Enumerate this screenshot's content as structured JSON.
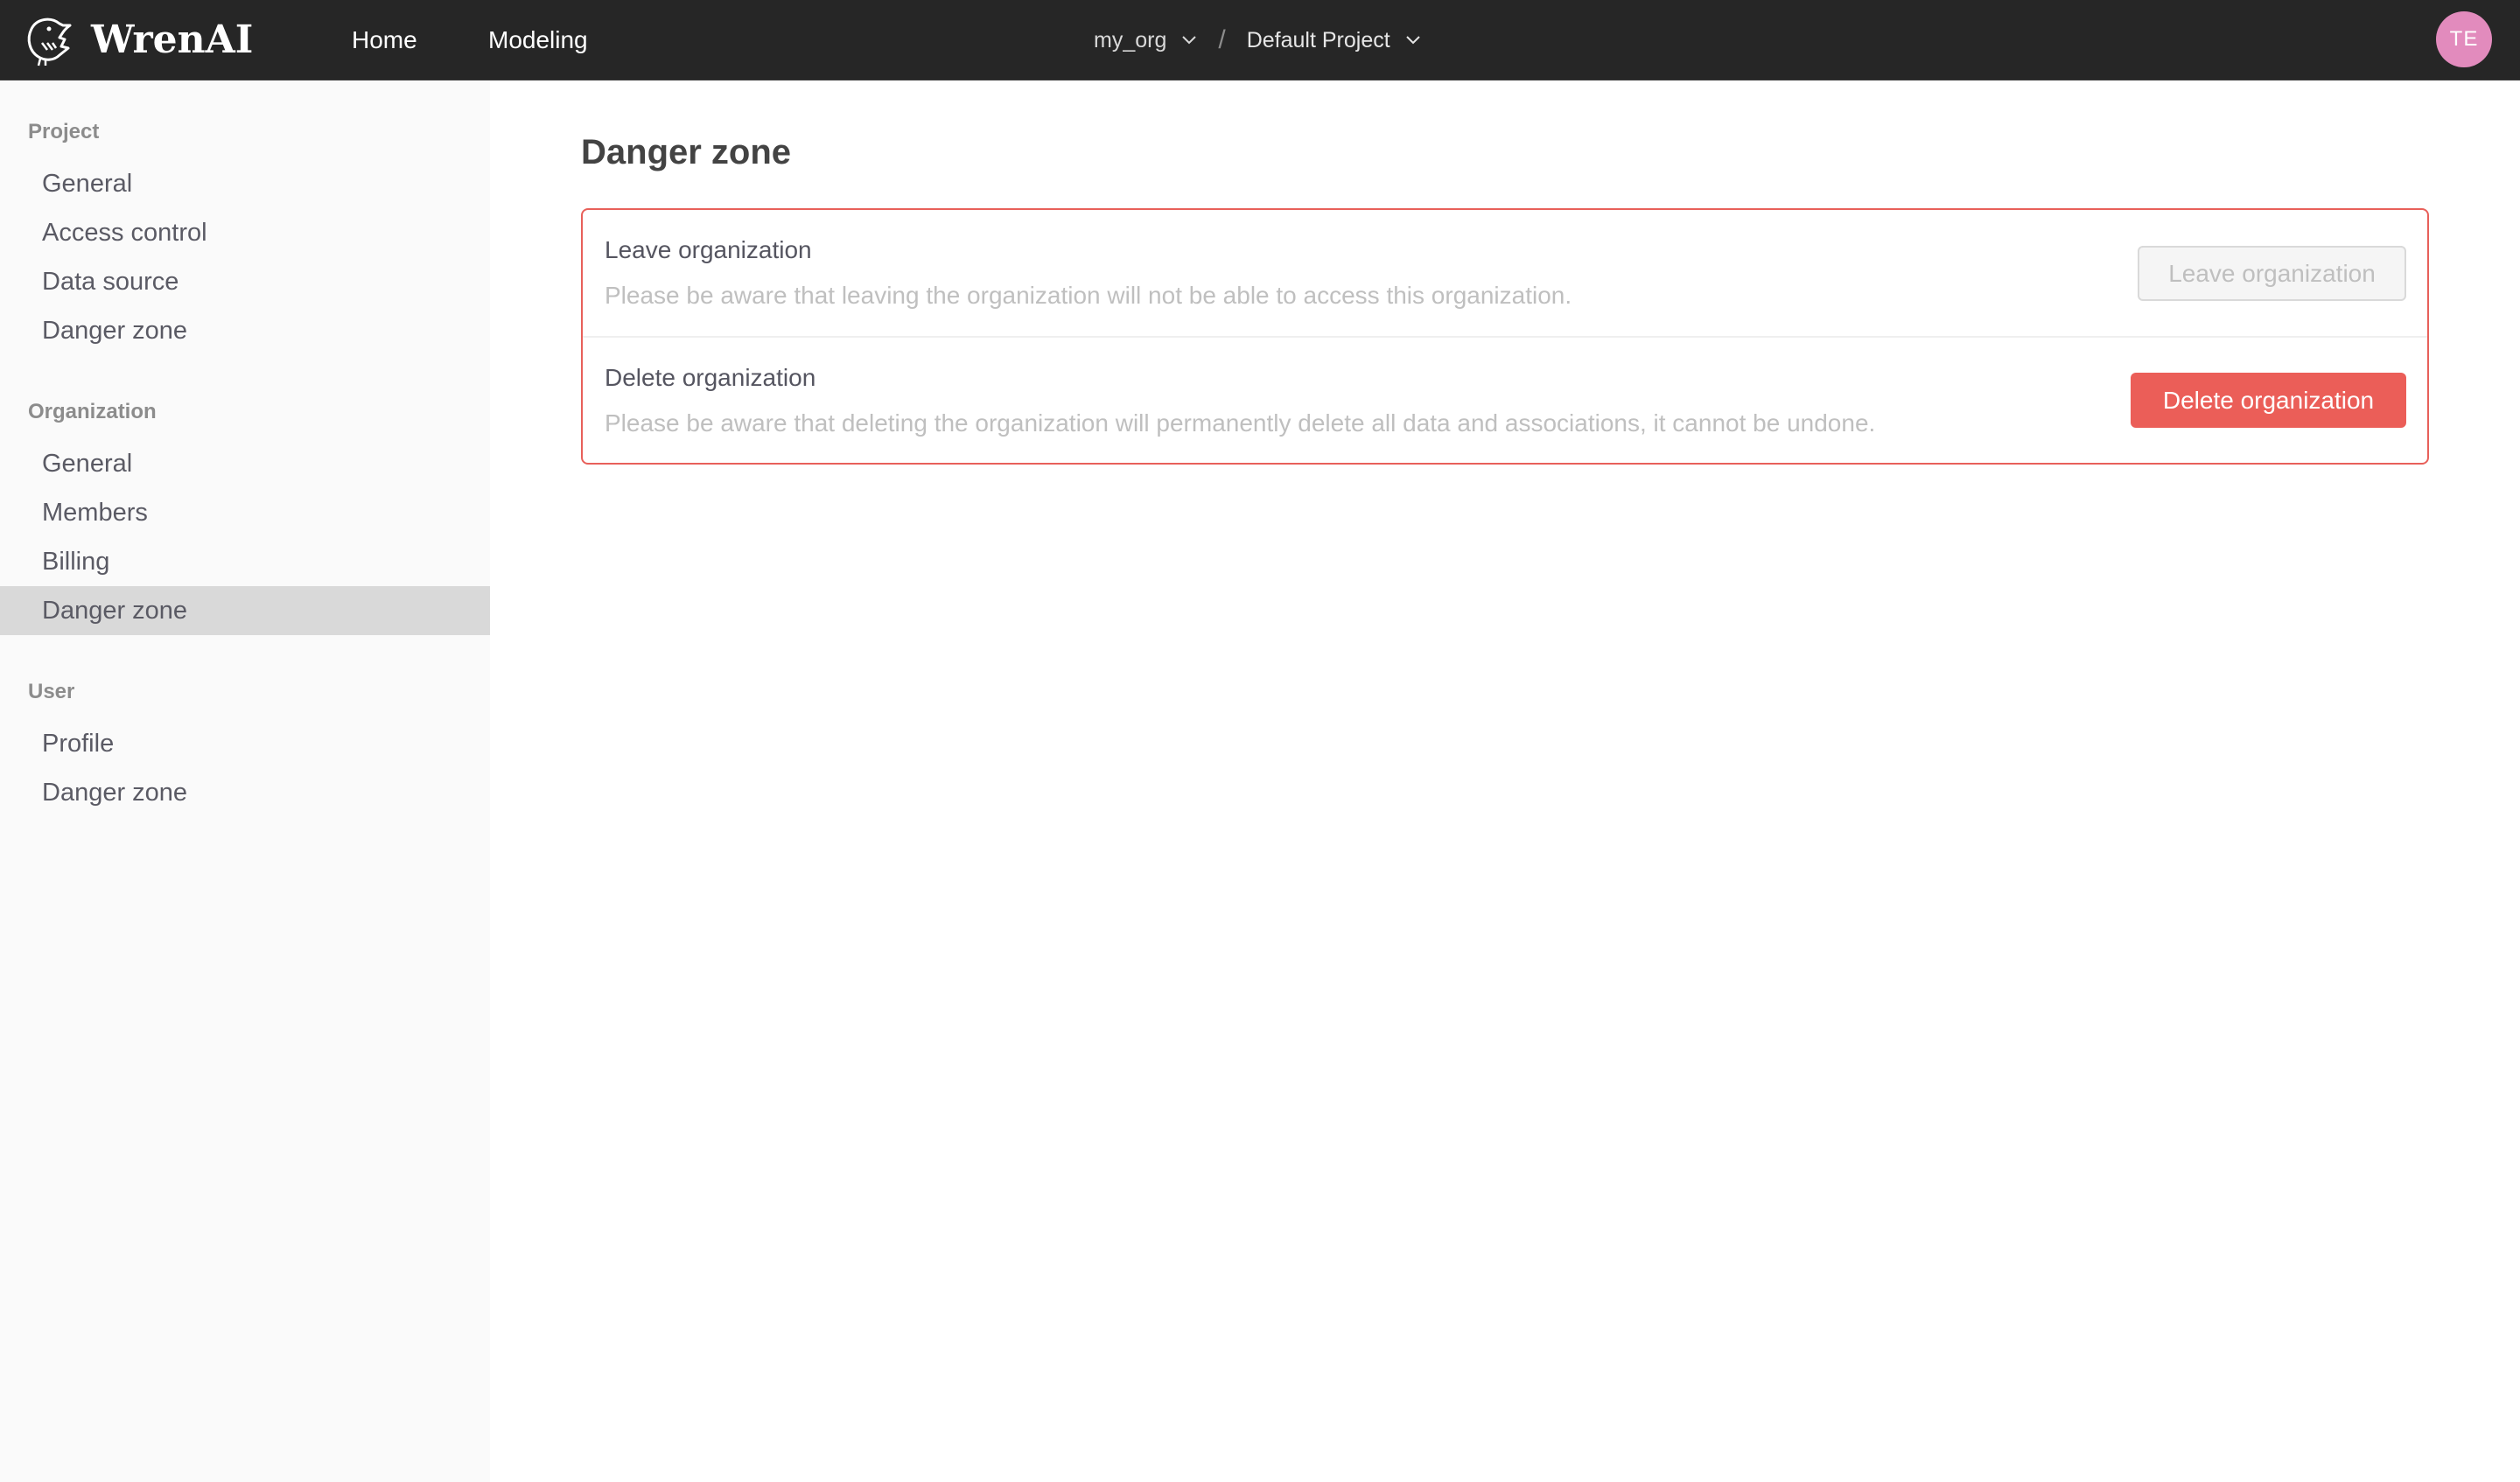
{
  "header": {
    "brand": "WrenAI",
    "nav": [
      {
        "label": "Home"
      },
      {
        "label": "Modeling"
      }
    ],
    "breadcrumb": {
      "organization": "my_org",
      "separator": "/",
      "project": "Default Project"
    },
    "avatar_initials": "TE",
    "avatar_color": "#e28bbd"
  },
  "sidebar": {
    "groups": [
      {
        "title": "Project",
        "items": [
          {
            "label": "General"
          },
          {
            "label": "Access control"
          },
          {
            "label": "Data source"
          },
          {
            "label": "Danger zone"
          }
        ]
      },
      {
        "title": "Organization",
        "items": [
          {
            "label": "General"
          },
          {
            "label": "Members"
          },
          {
            "label": "Billing"
          },
          {
            "label": "Danger zone",
            "active": true
          }
        ]
      },
      {
        "title": "User",
        "items": [
          {
            "label": "Profile"
          },
          {
            "label": "Danger zone"
          }
        ]
      }
    ]
  },
  "main": {
    "title": "Danger zone",
    "accent_color": "#e8605a",
    "rows": [
      {
        "title": "Leave organization",
        "description": "Please be aware that leaving the organization will not be able to access this organization.",
        "button_label": "Leave organization",
        "button_disabled": true
      },
      {
        "title": "Delete organization",
        "description": "Please be aware that deleting the organization will permanently delete all data and associations, it cannot be undone.",
        "button_label": "Delete organization",
        "button_color": "#eb5e58"
      }
    ]
  }
}
